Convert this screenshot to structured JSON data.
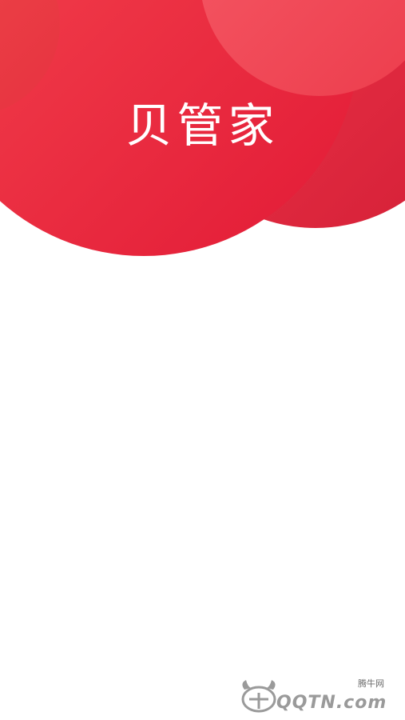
{
  "splash": {
    "app_name": "贝管家",
    "colors": {
      "primary_red": "#e8283c",
      "light_red": "#f24a55",
      "dark_red": "#d81f36",
      "background": "#ffffff"
    }
  },
  "watermark": {
    "brand_cn": "腾牛网",
    "brand_en": "QQTN.com",
    "icon": "bull-logo-icon"
  }
}
